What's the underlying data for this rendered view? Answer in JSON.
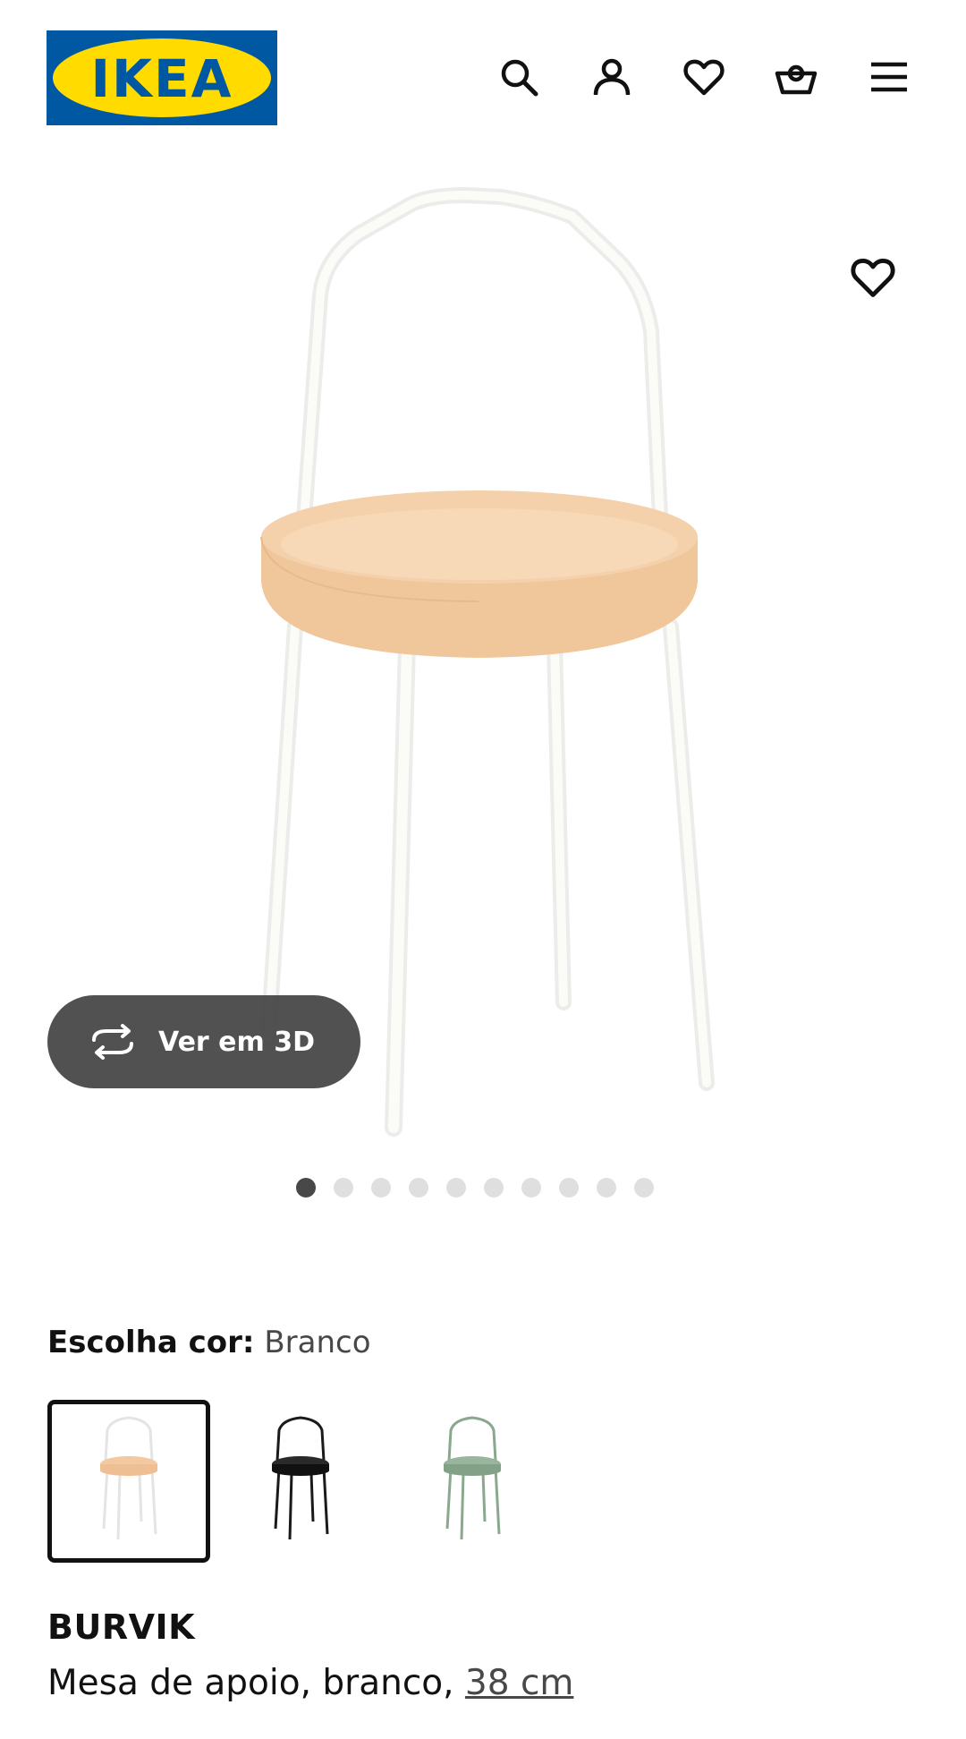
{
  "header": {
    "logo_text": "IKEA",
    "icons": [
      "search-icon",
      "account-icon",
      "heart-icon",
      "cart-icon",
      "menu-icon"
    ]
  },
  "gallery": {
    "view3d_label": "Ver em 3D",
    "slide_count": 10,
    "active_slide": 1
  },
  "color_choice": {
    "label": "Escolha cor:",
    "selected": "Branco",
    "swatches": [
      {
        "name": "Branco",
        "top": "#f2c9a0",
        "frame": "#eeeeee"
      },
      {
        "name": "Preto",
        "top": "#1a1a1a",
        "frame": "#1a1a1a"
      },
      {
        "name": "Verde",
        "top": "#8aa88e",
        "frame": "#8aa88e"
      }
    ]
  },
  "product": {
    "name": "BURVIK",
    "description": "Mesa de apoio, branco, ",
    "size_link": "38 cm"
  },
  "colors": {
    "brand_blue": "#0058a3",
    "brand_yellow": "#ffdb00",
    "view3d_bg": "#484848"
  }
}
